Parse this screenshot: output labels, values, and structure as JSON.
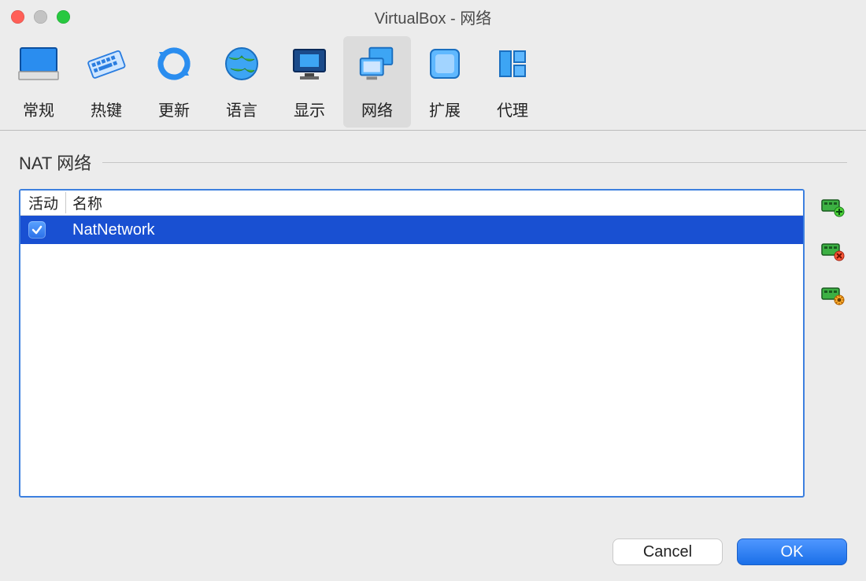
{
  "window": {
    "title": "VirtualBox - 网络"
  },
  "toolbar": {
    "items": [
      {
        "id": "general",
        "label": "常规"
      },
      {
        "id": "hotkeys",
        "label": "热键"
      },
      {
        "id": "update",
        "label": "更新"
      },
      {
        "id": "language",
        "label": "语言"
      },
      {
        "id": "display",
        "label": "显示"
      },
      {
        "id": "network",
        "label": "网络",
        "selected": true
      },
      {
        "id": "extension",
        "label": "扩展"
      },
      {
        "id": "proxy",
        "label": "代理"
      }
    ]
  },
  "section": {
    "title": "NAT 网络"
  },
  "table": {
    "columns": {
      "active": "活动",
      "name": "名称"
    },
    "rows": [
      {
        "active": true,
        "name": "NatNetwork",
        "selected": true
      }
    ]
  },
  "side_actions": {
    "add": "add-nat-network",
    "remove": "remove-nat-network",
    "edit": "edit-nat-network"
  },
  "footer": {
    "cancel": "Cancel",
    "ok": "OK"
  }
}
